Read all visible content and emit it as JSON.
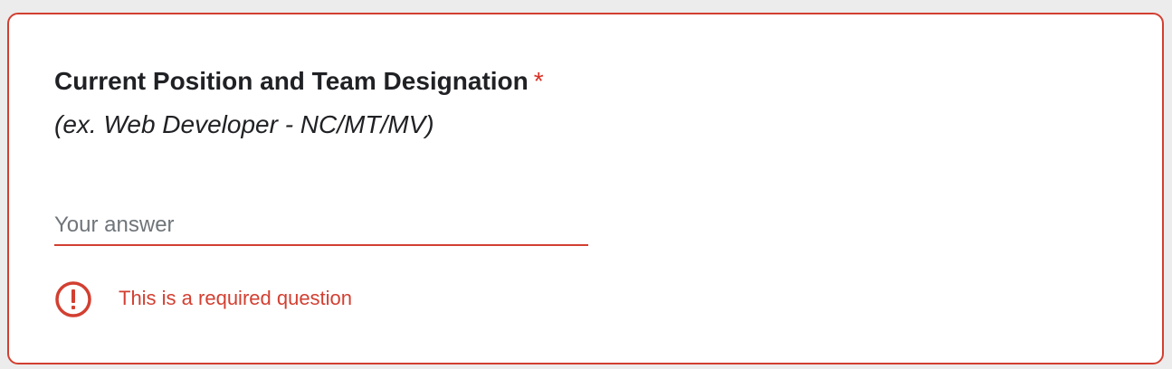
{
  "question": {
    "title": "Current Position and Team Designation",
    "required_marker": "*",
    "subtitle": "(ex. Web Developer - NC/MT/MV)"
  },
  "answer": {
    "value": "",
    "placeholder": "Your answer"
  },
  "error": {
    "icon": "error-exclamation-icon",
    "message": "This is a required question"
  },
  "colors": {
    "error": "#d23f31",
    "text": "#202124",
    "placeholder": "#70757a",
    "background": "#ececec",
    "card": "#ffffff"
  }
}
